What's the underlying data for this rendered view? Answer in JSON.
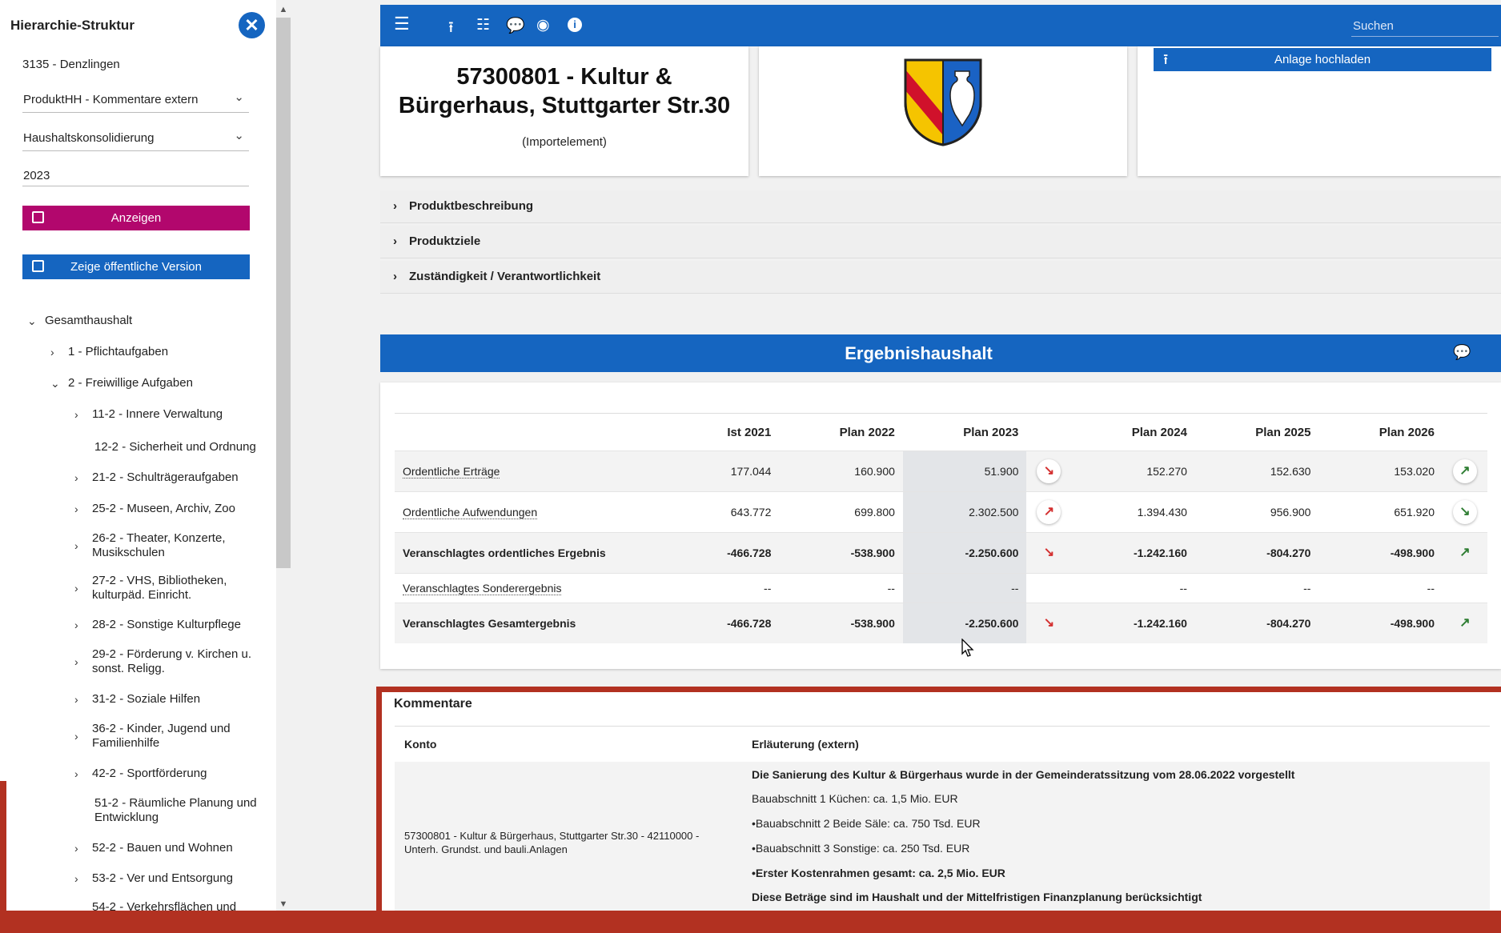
{
  "sidebar": {
    "title": "Hierarchie-Struktur",
    "close_glyph": "✕",
    "org": "3135 - Denzlingen",
    "select1": "ProduktHH - Kommentare extern",
    "select2": "Haushaltskonsolidierung",
    "year": "2023",
    "btn_show": "Anzeigen",
    "btn_public": "Zeige öffentliche Version",
    "tree": {
      "root": "Gesamthaushalt",
      "n1": "1 - Pflichtaufgaben",
      "n2": "2 - Freiwillige Aufgaben",
      "c1": "11-2 - Innere Verwaltung",
      "c2": "12-2 - Sicherheit und Ordnung",
      "c3": "21-2 - Schulträgeraufgaben",
      "c4": "25-2 - Museen, Archiv, Zoo",
      "c5a": "26-2 - Theater, Konzerte,",
      "c5b": "Musikschulen",
      "c6a": "27-2 - VHS, Bibliotheken,",
      "c6b": "kulturpäd. Einricht.",
      "c7": "28-2 - Sonstige Kulturpflege",
      "c8a": "29-2 - Förderung v. Kirchen u.",
      "c8b": "sonst. Religg.",
      "c9": "31-2 - Soziale Hilfen",
      "c10a": "36-2 - Kinder, Jugend und",
      "c10b": "Familienhilfe",
      "c11": "42-2 - Sportförderung",
      "c12a": "51-2 - Räumliche Planung und",
      "c12b": "Entwicklung",
      "c13": "52-2 - Bauen und Wohnen",
      "c14": "53-2 - Ver und Entsorgung",
      "c15": "54-2 - Verkehrsflächen und"
    }
  },
  "topbar": {
    "search_placeholder": "Suchen"
  },
  "product": {
    "title_line1": "57300801 - Kultur &",
    "title_line2": "Bürgerhaus, Stuttgarter Str.30",
    "subtitle": "(Importelement)",
    "upload_label": "Anlage hochladen"
  },
  "accordion": [
    "Produktbeschreibung",
    "Produktziele",
    "Zuständigkeit / Verantwortlichkeit"
  ],
  "ergebnis": {
    "title": "Ergebnishaushalt",
    "headers": [
      "",
      "Ist 2021",
      "Plan 2022",
      "Plan 2023",
      "",
      "Plan 2024",
      "Plan 2025",
      "Plan 2026",
      ""
    ],
    "rows": [
      {
        "label": "Ordentliche Erträge",
        "ist2021": "177.044",
        "plan2022": "160.900",
        "plan2023": "51.900",
        "plan2024": "152.270",
        "plan2025": "152.630",
        "plan2026": "153.020"
      },
      {
        "label": "Ordentliche Aufwendungen",
        "ist2021": "643.772",
        "plan2022": "699.800",
        "plan2023": "2.302.500",
        "plan2024": "1.394.430",
        "plan2025": "956.900",
        "plan2026": "651.920"
      },
      {
        "label": "Veranschlagtes ordentliches Ergebnis",
        "ist2021": "-466.728",
        "plan2022": "-538.900",
        "plan2023": "-2.250.600",
        "plan2024": "-1.242.160",
        "plan2025": "-804.270",
        "plan2026": "-498.900"
      },
      {
        "label": "Veranschlagtes Sonderergebnis",
        "ist2021": "--",
        "plan2022": "--",
        "plan2023": "--",
        "plan2024": "--",
        "plan2025": "--",
        "plan2026": "--"
      },
      {
        "label": "Veranschlagtes Gesamtergebnis",
        "ist2021": "-466.728",
        "plan2022": "-538.900",
        "plan2023": "-2.250.600",
        "plan2024": "-1.242.160",
        "plan2025": "-804.270",
        "plan2026": "-498.900"
      }
    ],
    "colors": {
      "down": "#d32f2f",
      "up": "#2e7d32"
    }
  },
  "kommentare": {
    "title": "Kommentare",
    "col_konto": "Konto",
    "col_erl": "Erläuterung (extern)",
    "konto_line1": "57300801 - Kultur & Bürgerhaus, Stuttgarter Str.30 - 42110000 -",
    "konto_line2": "Unterh. Grundst. und bauli.Anlagen",
    "lines": [
      "Die Sanierung des Kultur & Bürgerhaus wurde in der Gemeinderatssitzung vom 28.06.2022 vorgestellt",
      "Bauabschnitt 1 Küchen: ca. 1,5 Mio. EUR",
      "•Bauabschnitt 2 Beide Säle: ca. 750 Tsd. EUR",
      "•Bauabschnitt 3 Sonstige: ca. 250 Tsd. EUR",
      "•Erster Kostenrahmen gesamt: ca. 2,5 Mio. EUR",
      "Diese Beträge sind im Haushalt und der Mittelfristigen Finanzplanung berücksichtigt"
    ]
  },
  "theme": {
    "primary": "#1565c0",
    "magenta": "#b2076d",
    "frame_red": "#b23121"
  }
}
